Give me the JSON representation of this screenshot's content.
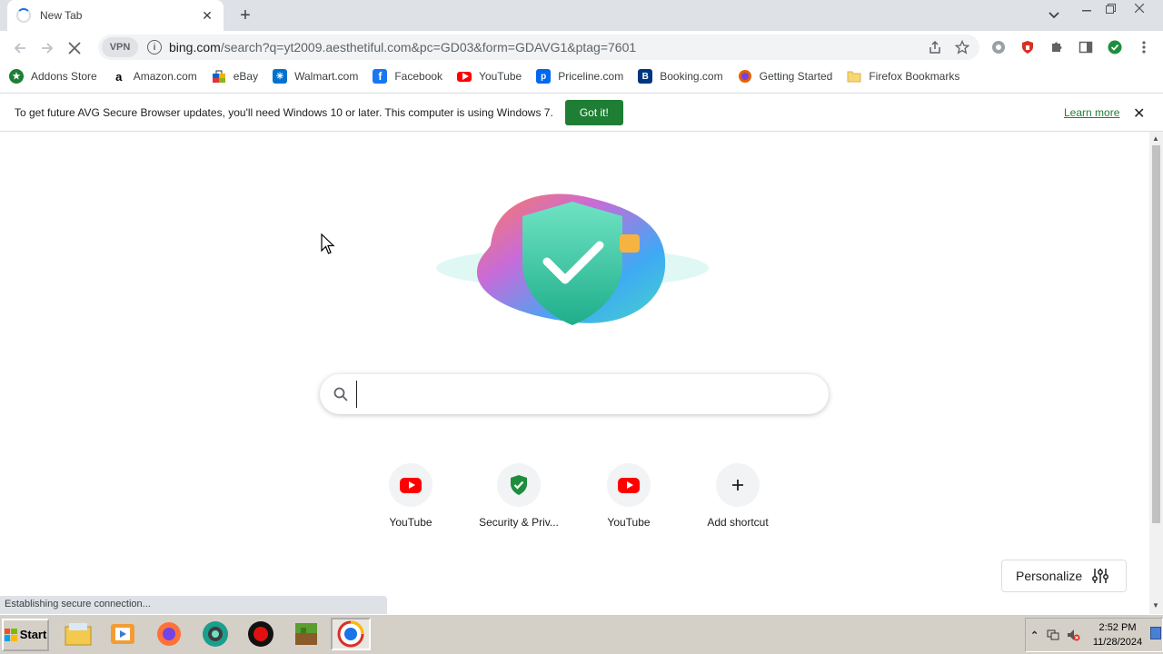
{
  "browser": {
    "tab_title": "New Tab",
    "url_main": "bing.com",
    "url_rest": "/search?q=yt2009.aesthetiful.com&pc=GD03&form=GDAVG1&ptag=7601",
    "vpn_label": "VPN"
  },
  "bookmarks": [
    {
      "label": "Addons Store",
      "icon": "addons-store-icon",
      "color": "#1e7e34"
    },
    {
      "label": "Amazon.com",
      "icon": "amazon-icon",
      "color": "#000000"
    },
    {
      "label": "eBay",
      "icon": "ebay-icon",
      "color": "#e53238"
    },
    {
      "label": "Walmart.com",
      "icon": "walmart-icon",
      "color": "#0071ce"
    },
    {
      "label": "Facebook",
      "icon": "facebook-icon",
      "color": "#1877f2"
    },
    {
      "label": "YouTube",
      "icon": "youtube-icon",
      "color": "#ff0000"
    },
    {
      "label": "Priceline.com",
      "icon": "priceline-icon",
      "color": "#0068ef"
    },
    {
      "label": "Booking.com",
      "icon": "booking-icon",
      "color": "#003580"
    },
    {
      "label": "Getting Started",
      "icon": "firefox-icon",
      "color": "#e66000"
    },
    {
      "label": "Firefox Bookmarks",
      "icon": "folder-icon",
      "color": "#f7d774"
    }
  ],
  "infobar": {
    "message": "To get future AVG Secure Browser updates, you'll need Windows 10 or later. This computer is using Windows 7.",
    "button": "Got it!",
    "link": "Learn more"
  },
  "search": {
    "placeholder": ""
  },
  "shortcuts": [
    {
      "label": "YouTube",
      "icon": "youtube-icon"
    },
    {
      "label": "Security & Priv...",
      "icon": "shield-check-icon"
    },
    {
      "label": "YouTube",
      "icon": "youtube-icon"
    },
    {
      "label": "Add shortcut",
      "icon": "plus-icon"
    }
  ],
  "personalize_label": "Personalize",
  "status_text": "Establishing secure connection...",
  "taskbar": {
    "start_label": "Start",
    "time": "2:52 PM",
    "date": "11/28/2024"
  },
  "colors": {
    "accent_green": "#1e7e34",
    "youtube_red": "#ff0000"
  }
}
